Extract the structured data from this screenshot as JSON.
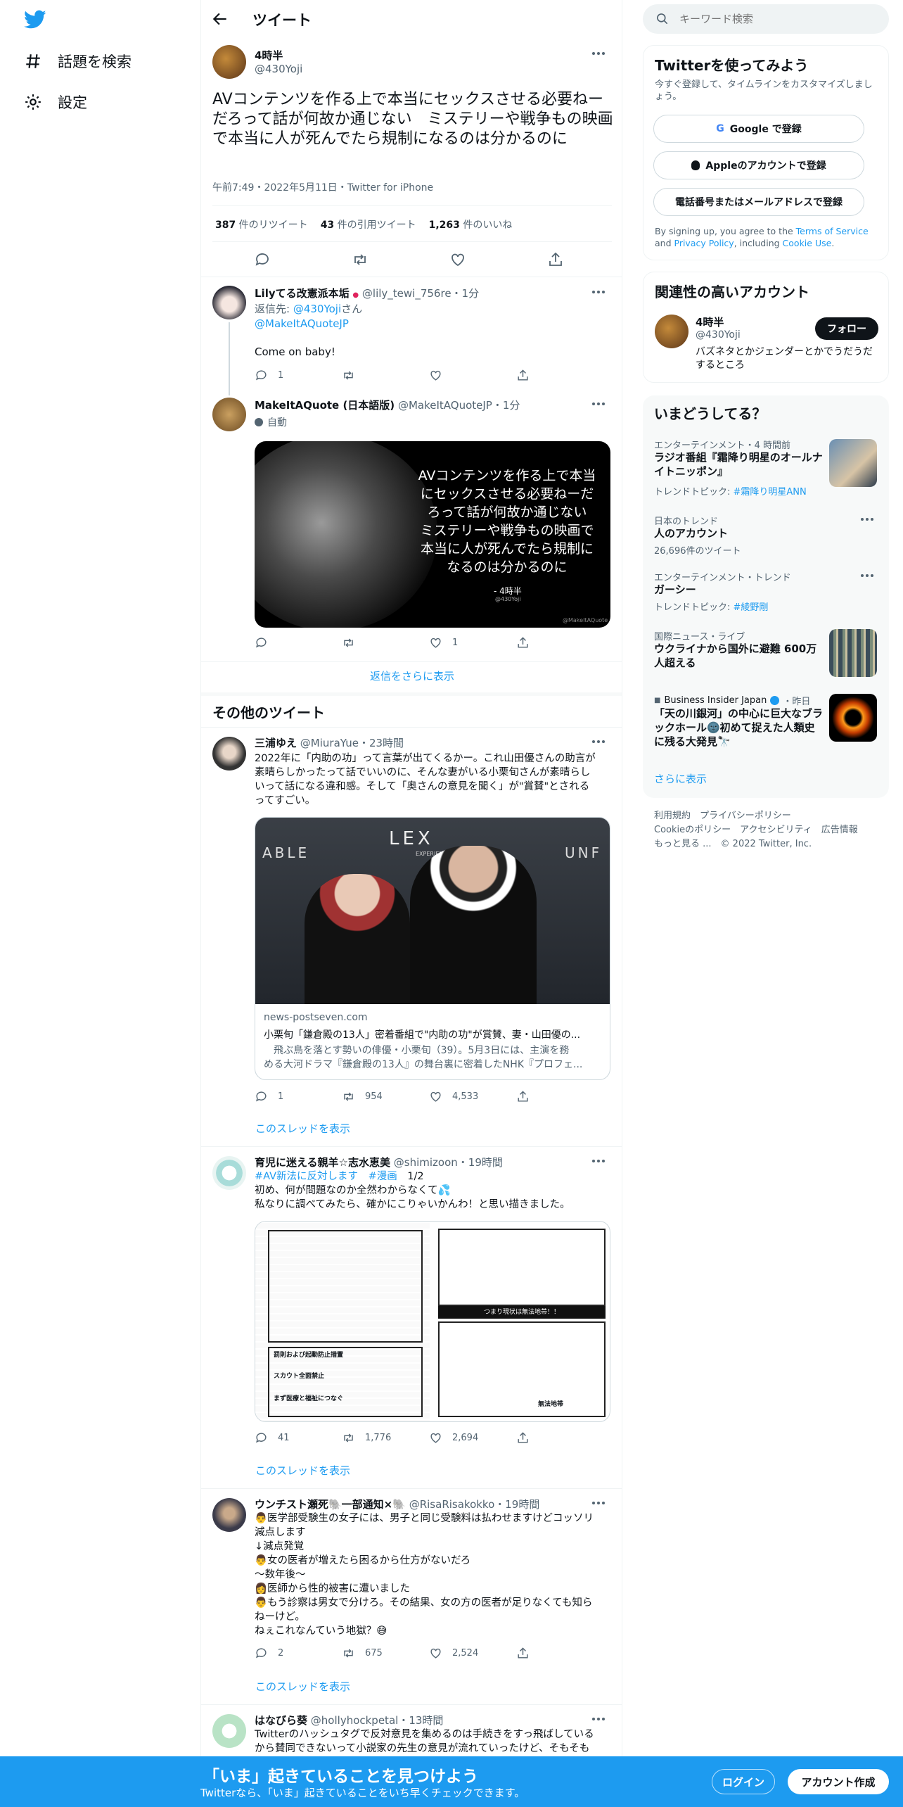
{
  "nav": {
    "explore": "話題を検索",
    "settings": "設定"
  },
  "header": {
    "title": "ツイート"
  },
  "main_tweet": {
    "name": "4時半",
    "handle": "@430Yoji",
    "text": "AVコンテンツを作る上で本当にセックスさせる必要ねーだろって話が何故か通じない　ミステリーや戦争もの映画で本当に人が死んでたら規制になるのは分かるのに",
    "meta": "午前7:49・2022年5月11日・Twitter for iPhone",
    "retweets_num": "387",
    "retweets_label": " 件のリツイート",
    "quotes_num": "43",
    "quotes_label": " 件の引用ツイート",
    "likes_num": "1,263",
    "likes_label": " 件のいいね"
  },
  "reply1": {
    "name": "Lilyてる改憲派本垢",
    "flag": "●",
    "handle": "@lily_tewi_756re",
    "time": "・1分",
    "reply_prefix": "返信先: ",
    "reply_to": "@430Yoji",
    "reply_suffix": "さん",
    "reply_to2": "@MakeItAQuoteJP",
    "text": "Come on baby!",
    "replies": "1",
    "retweets": "",
    "likes": ""
  },
  "reply2": {
    "name": "MakeItAQuote (日本語版)",
    "handle": "@MakeItAQuoteJP",
    "time": "・1分",
    "badge": "自動",
    "quote_lines": [
      "AVコンテンツを作る上で本当",
      "にセックスさせる必要ねーだ",
      "ろって話が何故か通じない",
      "ミステリーや戦争もの映画で",
      "本当に人が死んでたら規制に",
      "なるのは分かるのに"
    ],
    "quote_author": "- 4時半",
    "quote_handle": "@430Yoji",
    "watermark": "@MakeItAQuote",
    "replies": "",
    "retweets": "",
    "likes": "1"
  },
  "show_more_replies": "返信をさらに表示",
  "more_tweets_title": "その他のツイート",
  "tweet3": {
    "name": "三浦ゆえ",
    "handle": "@MiuraYue",
    "time": "・23時間",
    "text_lines": [
      "2022年に「内助の功」って言葉が出てくるかー。これ山田優さんの助言が",
      "素晴らしかったって話でいいのに、そんな妻がいる小栗旬さんが素晴らし",
      "いって話になる違和感。そして「奥さんの意見を聞く」が\"賞賛\"とされる",
      "ってすごい。"
    ],
    "card_bg_left": "ABLE",
    "card_bg_right": "UNF",
    "card_logo": "LEX",
    "card_logo_sub": "EXPERIENCE",
    "card_domain": "news-postseven.com",
    "card_title": "小栗旬「鎌倉殿の13人」密着番組で\"内助の功\"が賞賛、妻・山田優の...",
    "card_desc1": "　飛ぶ鳥を落とす勢いの俳優・小栗旬（39）。5月3日には、主演を務",
    "card_desc2": "める大河ドラマ『鎌倉殿の13人』の舞台裏に密着したNHK『プロフェ...",
    "replies": "1",
    "retweets": "954",
    "likes": "4,533",
    "show_thread": "このスレッドを表示"
  },
  "tweet4": {
    "name": "育児に迷える親羊☆志水恵美",
    "handle": "@shimizoon",
    "time": "・19時間",
    "tag1": "#AV新法に反対します",
    "tag2": "#漫画",
    "count": "1/2",
    "line1": "初め、何が問題なのか全然わからなくて💦",
    "line2": "私なりに調べてみたら、確かにこりゃいかんわ！と思い描きました。",
    "manga_banner": "つまり現状は無法地帯！！",
    "manga_bottom": "無法地帯",
    "manga_left1": "罰則および起動防止措置",
    "manga_left2": "スカウト全面禁止",
    "manga_left3": "まず医療と福祉につなぐ",
    "replies": "41",
    "retweets": "1,776",
    "likes": "2,694",
    "show_thread": "このスレッドを表示"
  },
  "tweet5": {
    "name": "ウンチスト瀬死🐘一部通知×🐘",
    "handle": "@RisaRisakokko",
    "time": "・19時間",
    "lines": [
      "👨医学部受験生の女子には、男子と同じ受験料は払わせますけどコッソリ",
      "減点します",
      "↓減点発覚",
      "👨女の医者が増えたら困るから仕方がないだろ",
      "〜数年後〜",
      "👩医師から性的被害に遭いました",
      "👨もう診察は男女で分けろ。その結果、女の方の医者が足りなくても知ら",
      "ねーけど。",
      "ねぇこれなんていう地獄？😅"
    ],
    "replies": "2",
    "retweets": "675",
    "likes": "2,524",
    "show_thread": "このスレッドを表示"
  },
  "tweet6": {
    "name": "はなびら葵",
    "handle": "@hollyhockpetal",
    "time": "・13時間",
    "line1": "Twitterのハッシュタグで反対意見を集めるのは手続きをすっ飛ばしている",
    "line2": "から賛同できないって小説家の先生の意見が流れていったけど、そもそも"
  },
  "search": {
    "placeholder": "キーワード検索"
  },
  "signup_panel": {
    "title": "Twitterを使ってみよう",
    "desc": "今すぐ登録して、タイムラインをカスタマイズしましょう。",
    "google": "Google で登録",
    "apple": "Appleのアカウントで登録",
    "phone": "電話番号またはメールアドレスで登録",
    "terms_pre": "By signing up, you agree to the ",
    "terms": "Terms of Service",
    "and": " and ",
    "privacy": "Privacy Policy",
    "including": ", including ",
    "cookie": "Cookie Use",
    "period": "."
  },
  "relevant": {
    "title": "関連性の高いアカウント",
    "name": "4時半",
    "handle": "@430Yoji",
    "follow": "フォロー",
    "bio": "バズネタとかジェンダーとかでうだうだするところ"
  },
  "trends": {
    "title": "いまどうしてる？",
    "items": [
      {
        "cat": "エンターテインメント・4 時間前",
        "title": "ラジオ番組『霜降り明星のオールナイトニッポン』",
        "sub_label": "トレンドトピック: ",
        "sub_link": "#霜降り明星ANN"
      },
      {
        "cat": "日本のトレンド",
        "title": "人のアカウント",
        "sub": "26,696件のツイート"
      },
      {
        "cat": "エンターテインメント・トレンド",
        "title": "ガーシー",
        "sub_label": "トレンドトピック: ",
        "sub_link": "#綾野剛"
      },
      {
        "cat": "国際ニュース・ライブ",
        "title": "ウクライナから国外に避難 600万人超える"
      },
      {
        "cat": "Business Insider Japan",
        "title": "「天の川銀河」の中心に巨大なブラックホール🌚初めて捉えた人類史に残る大発見🔭",
        "time": "・昨日"
      }
    ],
    "show_more": "さらに表示"
  },
  "footer": {
    "terms": "利用規約",
    "privacy": "プライバシーポリシー",
    "cookie": "Cookieのポリシー",
    "access": "アクセシビリティ",
    "ads": "広告情報",
    "more": "もっと見る ...",
    "copy": "© 2022 Twitter, Inc."
  },
  "bottom_bar": {
    "title": "「いま」起きていることを見つけよう",
    "sub": "Twitterなら、「いま」起きていることをいち早くチェックできます。",
    "login": "ログイン",
    "signup": "アカウント作成"
  },
  "colors": {
    "accent": "#1d9bf0",
    "text": "#0f1419",
    "secondary": "#536471",
    "panel": "#f7f9f9"
  }
}
